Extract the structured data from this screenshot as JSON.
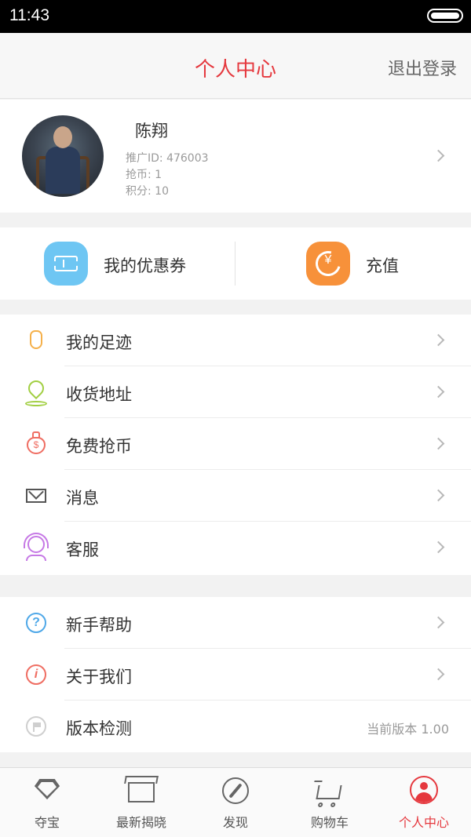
{
  "status_bar": {
    "time": "11:43"
  },
  "header": {
    "title": "个人中心",
    "logout_label": "退出登录"
  },
  "profile": {
    "name": "陈翔",
    "promo_id": "推广ID: 476003",
    "coins": "抢币: 1",
    "points": "积分: 10"
  },
  "quick_actions": {
    "coupon_label": "我的优惠券",
    "recharge_label": "充值",
    "recharge_symbol": "¥"
  },
  "menu_group_1": [
    {
      "label": "我的足迹",
      "icon": "footprint-icon"
    },
    {
      "label": "收货地址",
      "icon": "location-pin-icon"
    },
    {
      "label": "免费抢币",
      "icon": "money-bag-icon"
    },
    {
      "label": "消息",
      "icon": "envelope-icon"
    },
    {
      "label": "客服",
      "icon": "customer-service-icon"
    }
  ],
  "menu_group_2": [
    {
      "label": "新手帮助",
      "icon": "question-icon",
      "glyph": "?"
    },
    {
      "label": "关于我们",
      "icon": "info-icon",
      "glyph": "i"
    },
    {
      "label": "版本检测",
      "icon": "flag-icon",
      "value": "当前版本 1.00"
    }
  ],
  "tab_bar": [
    {
      "label": "夺宝",
      "icon": "diamond-icon"
    },
    {
      "label": "最新揭晓",
      "icon": "box-icon"
    },
    {
      "label": "发现",
      "icon": "compass-icon"
    },
    {
      "label": "购物车",
      "icon": "cart-icon"
    },
    {
      "label": "个人中心",
      "icon": "user-icon",
      "active": true
    }
  ],
  "colors": {
    "accent": "#e5383e",
    "coupon_icon_bg": "#6ec6f3",
    "recharge_icon_bg": "#f7913a"
  }
}
